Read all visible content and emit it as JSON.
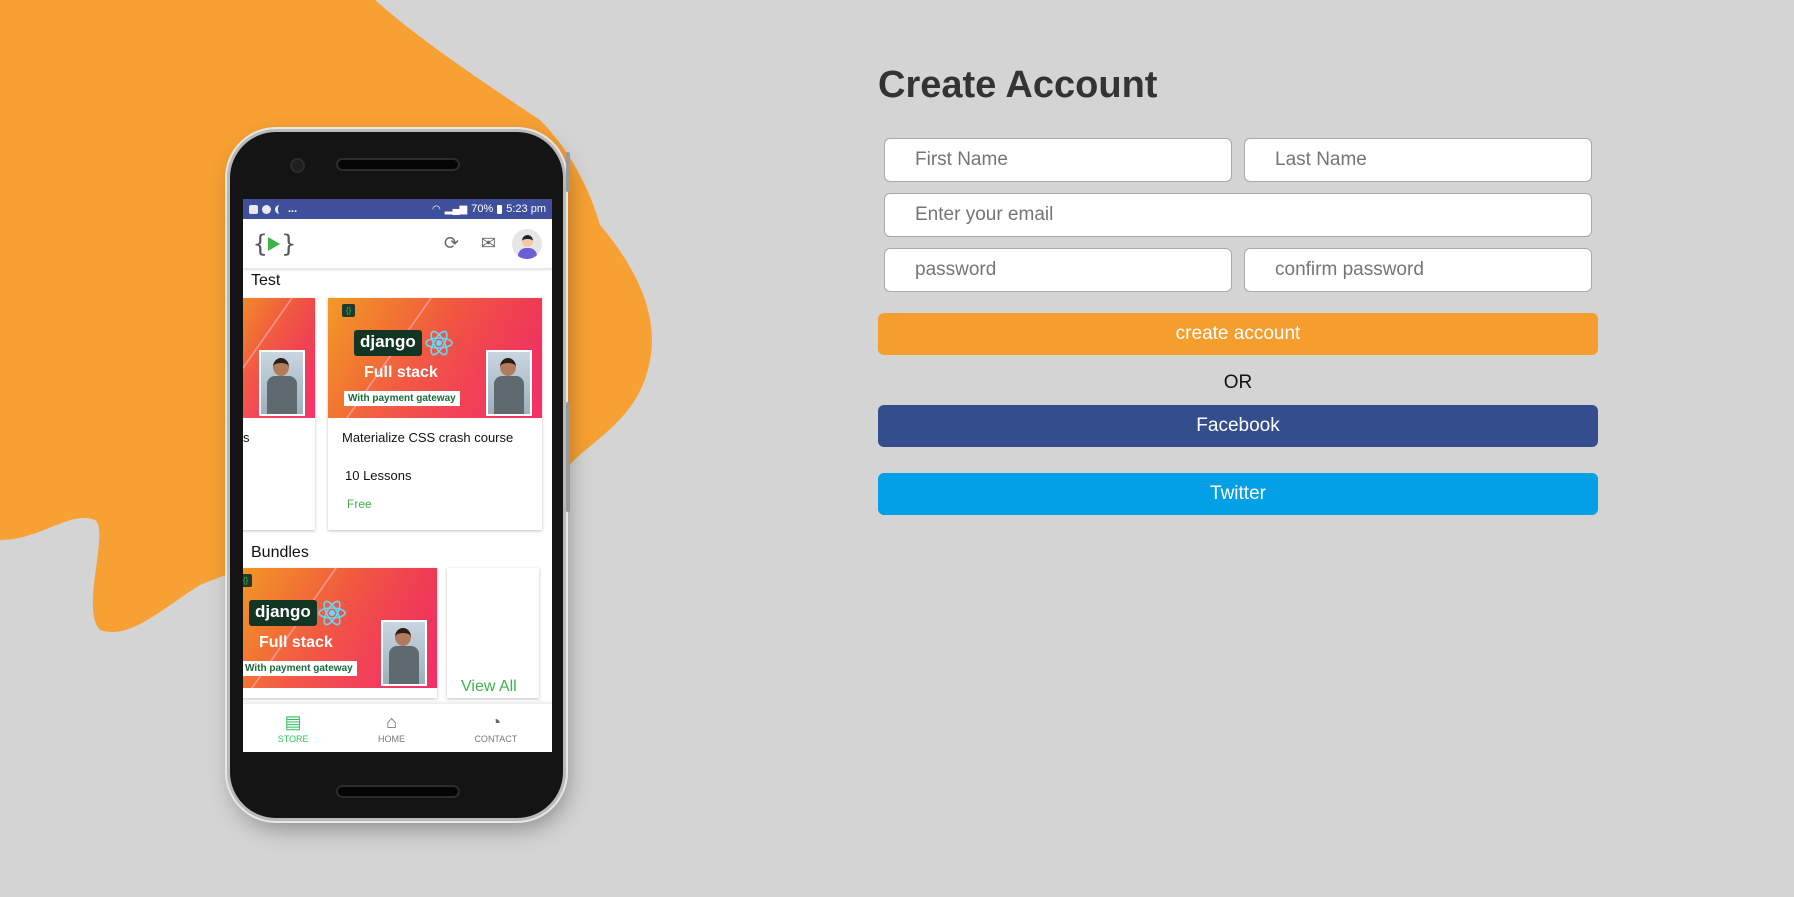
{
  "colors": {
    "background": "#d4d4d4",
    "blob": "#f7a033",
    "create_button": "#f59e2e",
    "facebook": "#344d8d",
    "twitter": "#03a0e6",
    "accent_green": "#3cb44a"
  },
  "phone": {
    "status_bar": {
      "left_dots": "...",
      "battery": "70%",
      "time": "5:23 pm"
    },
    "app_bar": {
      "logo_left": "{",
      "logo_right": "}"
    },
    "sections": [
      {
        "title": "Test",
        "partial_card_text": "s",
        "card": {
          "thumb": {
            "brand": "django",
            "headline": "Full stack",
            "tag": "With payment gateway"
          },
          "title": "Materialize CSS crash course",
          "lessons": "10 Lessons",
          "price": "Free"
        }
      },
      {
        "title": "Bundles",
        "card": {
          "thumb": {
            "brand": "django",
            "headline": "Full stack",
            "tag": "With payment gateway"
          }
        },
        "view_all": "View All"
      }
    ],
    "bottom_nav": [
      {
        "label": "STORE",
        "icon": "store-icon",
        "active": true
      },
      {
        "label": "HOME",
        "icon": "home-icon",
        "active": false
      },
      {
        "label": "CONTACT",
        "icon": "rss-icon",
        "active": false
      }
    ]
  },
  "form": {
    "title": "Create Account",
    "first_name": {
      "placeholder": "First Name",
      "value": ""
    },
    "last_name": {
      "placeholder": "Last Name",
      "value": ""
    },
    "email": {
      "placeholder": "Enter your email",
      "value": ""
    },
    "password": {
      "placeholder": "password",
      "value": ""
    },
    "confirm_password": {
      "placeholder": "confirm password",
      "value": ""
    },
    "create_label": "create account",
    "or_label": "OR",
    "facebook_label": "Facebook",
    "twitter_label": "Twitter"
  }
}
